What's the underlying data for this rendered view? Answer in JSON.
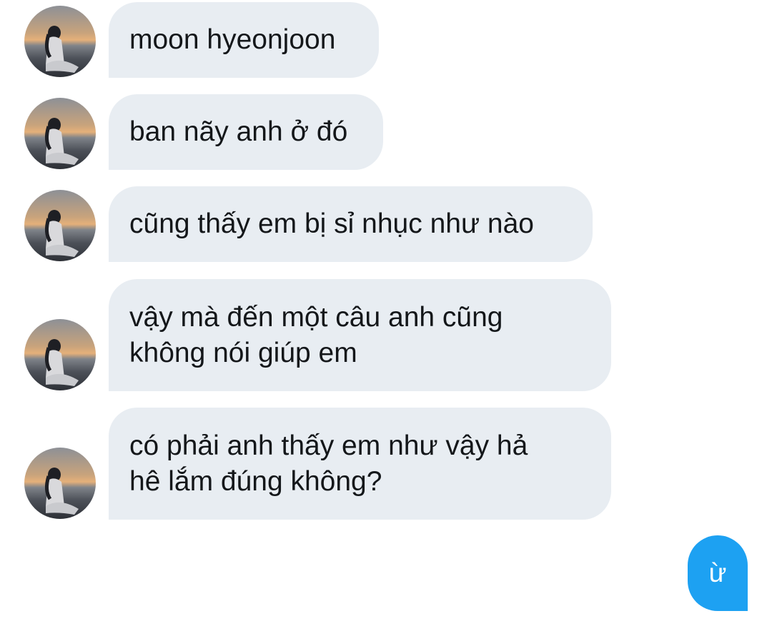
{
  "messages": [
    {
      "text": "moon hyeonjoon"
    },
    {
      "text": "ban nãy anh ở đó"
    },
    {
      "text": "cũng thấy em bị sỉ nhục như nào"
    },
    {
      "lines": [
        "vậy mà đến một câu anh cũng",
        "không nói giúp em"
      ]
    },
    {
      "lines": [
        "có phải anh thấy em như vậy hả",
        "hê lắm đúng không?"
      ]
    }
  ],
  "reply": {
    "text": "ừ"
  },
  "colors": {
    "incoming_bubble": "#e8edf2",
    "outgoing_bubble": "#1da1f2",
    "text": "#14171a"
  },
  "icons": {
    "avatar": "person-sitting-sunset-photo"
  }
}
